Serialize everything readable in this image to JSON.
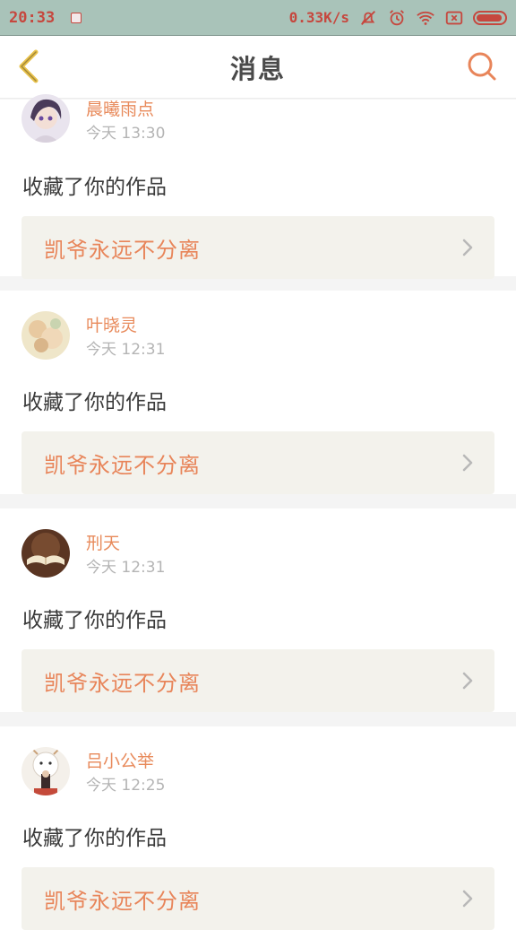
{
  "status_bar": {
    "time": "20:33",
    "net_speed": "0.33K/s",
    "icons": [
      "notification-icon",
      "mute-icon",
      "alarm-icon",
      "wifi-icon",
      "sim-off-icon",
      "battery-icon"
    ]
  },
  "header": {
    "title": "消息",
    "back_icon": "back-chevron-icon",
    "search_icon": "search-icon"
  },
  "colors": {
    "accent": "#e8855a",
    "back_icon": "#e8c24b",
    "status_text": "#c6473e",
    "status_bg": "#a9c3b9"
  },
  "messages": [
    {
      "user": "晨曦雨点",
      "time": "今天 13:30",
      "action": "收藏了你的作品",
      "work": "凯爷永远不分离"
    },
    {
      "user": "叶晓灵",
      "time": "今天 12:31",
      "action": "收藏了你的作品",
      "work": "凯爷永远不分离"
    },
    {
      "user": "刑天",
      "time": "今天 12:31",
      "action": "收藏了你的作品",
      "work": "凯爷永远不分离"
    },
    {
      "user": "吕小公举",
      "time": "今天 12:25",
      "action": "收藏了你的作品",
      "work": "凯爷永远不分离"
    }
  ]
}
